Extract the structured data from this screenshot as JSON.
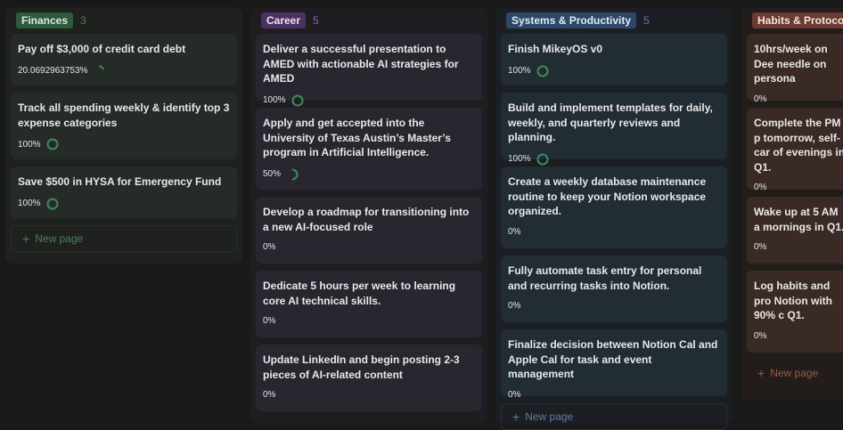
{
  "columns": [
    {
      "id": "finances",
      "tag": "Finances",
      "count": "3",
      "colors": {
        "column_bg": "#1e211e",
        "card_bg": "#252c27",
        "tag_bg": "#2c5a3c",
        "tag_text": "#dfe9e1",
        "count": "#4f7f5e",
        "ring": "#3f8a5b",
        "ring_track": "#2f3e33",
        "new_page": "#4f7f5e"
      },
      "cards": [
        {
          "title": "Pay off $3,000 of credit card debt",
          "progress_label": "20.0692963753%",
          "progress": 0.2007
        },
        {
          "title": "Track all spending weekly & identify top 3 expense categories",
          "progress_label": "100%",
          "progress": 1
        },
        {
          "title": "Save $500 in HYSA for Emergency Fund",
          "progress_label": "100%",
          "progress": 1
        }
      ],
      "new_page_label": "New page"
    },
    {
      "id": "career",
      "tag": "Career",
      "count": "5",
      "colors": {
        "column_bg": "#1f1d22",
        "card_bg": "#2a2630",
        "tag_bg": "#4b3163",
        "tag_text": "#ece3f3",
        "count": "#8b66ad",
        "ring": "#3f8a5b",
        "ring_track": "#3a3541",
        "new_page": "#8b66ad"
      },
      "cards": [
        {
          "title": "Deliver a successful presentation to AMED with actionable AI strategies for AMED",
          "progress_label": "100%",
          "progress": 1
        },
        {
          "title": "Apply and get accepted into the University of Texas Austin’s Master’s program in Artificial Intelligence.",
          "progress_label": "50%",
          "progress": 0.5
        },
        {
          "title": "Develop a roadmap for transitioning into a new AI-focused role",
          "progress_label": "0%",
          "progress": 0
        },
        {
          "title": "Dedicate 5 hours per week to learning core AI technical skills.",
          "progress_label": "0%",
          "progress": 0
        },
        {
          "title": "Update LinkedIn and begin posting 2-3 pieces of AI-related content",
          "progress_label": "0%",
          "progress": 0
        }
      ],
      "new_page_label": "New page"
    },
    {
      "id": "systems",
      "tag": "Systems & Productivity",
      "count": "5",
      "colors": {
        "column_bg": "#1b1f23",
        "card_bg": "#222c33",
        "tag_bg": "#2e4768",
        "tag_text": "#e2eaf4",
        "count": "#5b7ea6",
        "ring": "#3f8a5b",
        "ring_track": "#2f3b44",
        "new_page": "#5b7ea6"
      },
      "cards": [
        {
          "title": "Finish MikeyOS v0",
          "progress_label": "100%",
          "progress": 1
        },
        {
          "title": "Build and implement templates for daily, weekly, and quarterly reviews and planning.",
          "progress_label": "100%",
          "progress": 1
        },
        {
          "title": "Create a weekly database maintenance routine to keep your Notion workspace organized.",
          "progress_label": "0%",
          "progress": 0
        },
        {
          "title": "Fully automate task entry for personal and recurring tasks into Notion.",
          "progress_label": "0%",
          "progress": 0
        },
        {
          "title": "Finalize decision between Notion Cal and Apple Cal for task and event management",
          "progress_label": "0%",
          "progress": 0
        }
      ],
      "new_page_label": "New page"
    },
    {
      "id": "habits",
      "tag": "Habits & Protocols",
      "count": "",
      "colors": {
        "column_bg": "#221d1b",
        "card_bg": "#3a2a25",
        "tag_bg": "#6b3a30",
        "tag_text": "#f3e4df",
        "count": "#a0584a",
        "ring": "#3f8a5b",
        "ring_track": "#4a3832",
        "new_page": "#a0584a"
      },
      "cards": [
        {
          "title": "10hrs/week on Dee needle on persona",
          "progress_label": "0%",
          "progress": 0
        },
        {
          "title": "Complete the PM p tomorrow, self-car of evenings in Q1.",
          "progress_label": "0%",
          "progress": 0
        },
        {
          "title": "Wake up at 5 AM a mornings in Q1.",
          "progress_label": "0%",
          "progress": 0
        },
        {
          "title": "Log habits and pro Notion with 90% c Q1.",
          "progress_label": "0%",
          "progress": 0
        }
      ],
      "new_page_label": "New page"
    }
  ],
  "icons": {
    "add": "plus-icon",
    "progress": "progress-ring-icon"
  }
}
